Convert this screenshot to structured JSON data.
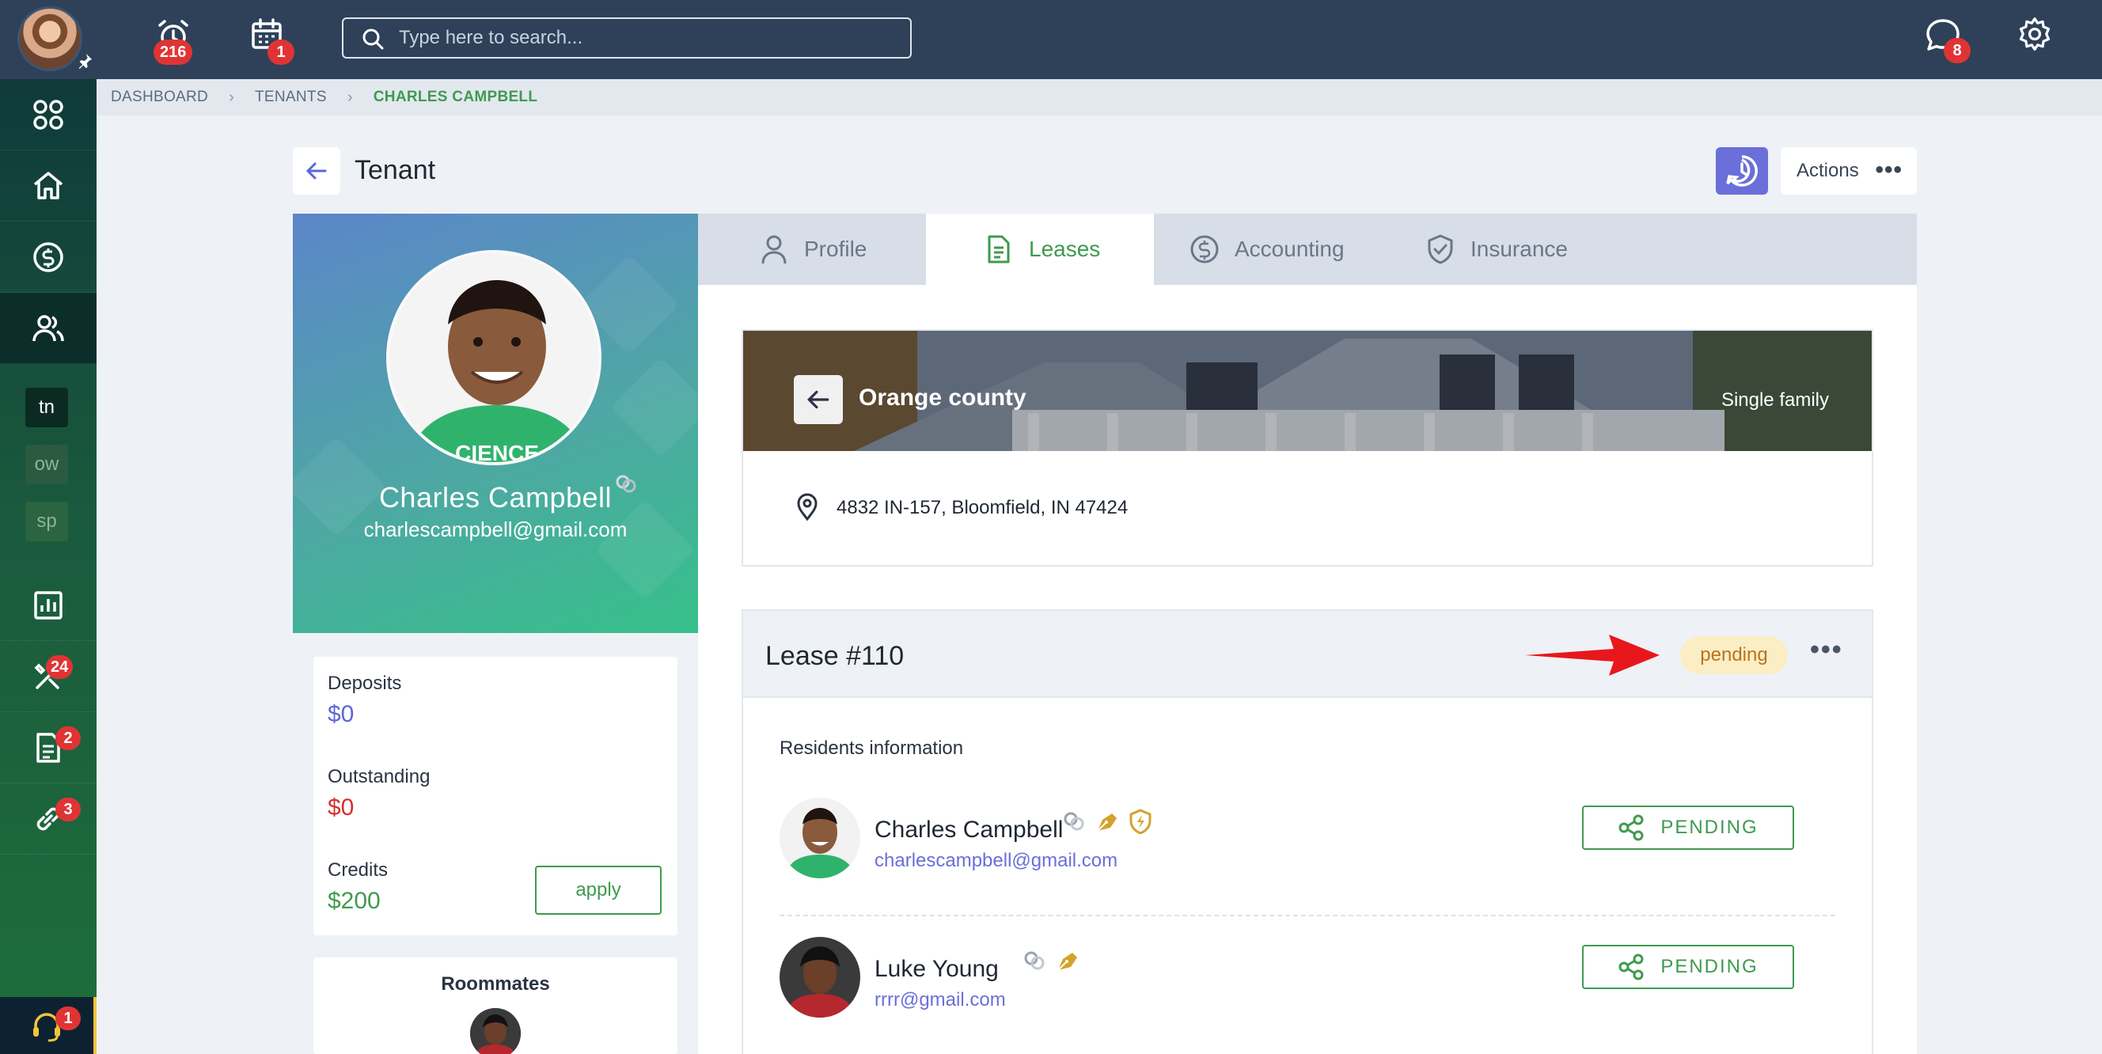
{
  "topbar": {
    "alarm_count": "216",
    "calendar_count": "1",
    "search_placeholder": "Type here to search...",
    "chat_count": "8"
  },
  "sidebar": {
    "tags": [
      "tn",
      "ow",
      "sp"
    ],
    "tools_count": "24",
    "documents_count": "2",
    "links_count": "3",
    "support_count": "1"
  },
  "breadcrumb": [
    "DASHBOARD",
    "TENANTS",
    "CHARLES CAMPBELL"
  ],
  "header": {
    "title": "Tenant",
    "actions_label": "Actions"
  },
  "profile": {
    "name": "Charles Campbell",
    "email": "charlescampbell@gmail.com"
  },
  "balances": {
    "deposits_label": "Deposits",
    "deposits_value": "$0",
    "outstanding_label": "Outstanding",
    "outstanding_value": "$0",
    "credits_label": "Credits",
    "credits_value": "$200",
    "apply_label": "apply"
  },
  "roommates": {
    "title": "Roommates"
  },
  "tabs": [
    {
      "label": "Profile"
    },
    {
      "label": "Leases"
    },
    {
      "label": "Accounting"
    },
    {
      "label": "Insurance"
    }
  ],
  "property": {
    "name": "Orange county",
    "type": "Single family",
    "address": "4832 IN-157, Bloomfield, IN 47424"
  },
  "lease": {
    "title": "Lease #110",
    "status": "pending",
    "residents_title": "Residents information",
    "residents": [
      {
        "name": "Charles Campbell",
        "email": "charlescampbell@gmail.com",
        "status": "PENDING"
      },
      {
        "name": "Luke Young",
        "email": "rrrr@gmail.com",
        "status": "PENDING"
      }
    ]
  },
  "colors": {
    "topbar": "#2e4159",
    "accent_green": "#3f9a4f",
    "accent_purple": "#6a6fd9",
    "badge_red": "#e03434",
    "pending_pill": "#fbedc4"
  }
}
